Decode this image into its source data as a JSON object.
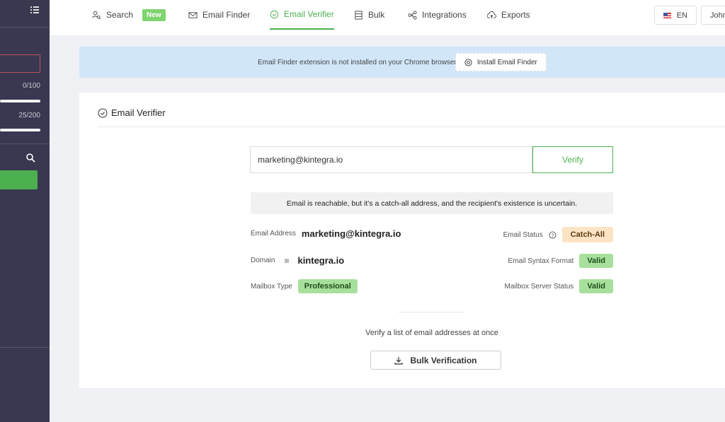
{
  "sidebar": {
    "credits": [
      {
        "label": "0/100",
        "fill": 0
      },
      {
        "label": "25/200",
        "fill": 0.125
      }
    ]
  },
  "nav": {
    "items": [
      {
        "label": "Search",
        "badge": "New",
        "icon": "user-search-icon"
      },
      {
        "label": "Email Finder",
        "icon": "mail-icon"
      },
      {
        "label": "Email Verifier",
        "icon": "check-circle-icon",
        "active": true
      },
      {
        "label": "Bulk",
        "icon": "list-icon"
      },
      {
        "label": "Integrations",
        "icon": "integrations-icon"
      },
      {
        "label": "Exports",
        "icon": "cloud-upload-icon"
      }
    ],
    "lang": "EN",
    "user": "John"
  },
  "banner": {
    "text": "Email Finder extension is not installed on your Chrome browser",
    "button": "Install Email Finder"
  },
  "card": {
    "title": "Email Verifier",
    "input_value": "marketing@kintegra.io",
    "verify": "Verify",
    "message": "Email is reachable, but it's a catch-all address, and the recipient's existence is uncertain.",
    "email_label": "Email Address",
    "email_value": "marketing@kintegra.io",
    "domain_label": "Domain",
    "domain_value": "kintegra.io",
    "mailbox_label": "Mailbox Type",
    "mailbox_value": "Professional",
    "status_label": "Email Status",
    "status_value": "Catch-All",
    "syntax_label": "Email Syntax Format",
    "syntax_value": "Valid",
    "server_label": "Mailbox Server Status",
    "server_value": "Valid",
    "bulk_text": "Verify a list of email addresses at once",
    "bulk_button": "Bulk Verification"
  },
  "colors": {
    "accent": "#4caf50",
    "sidebar": "#393850",
    "catch_all": "#fde3c4",
    "valid": "#a7e09c"
  }
}
